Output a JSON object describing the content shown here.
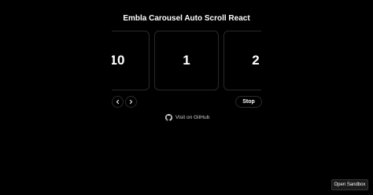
{
  "title": "Embla Carousel Auto Scroll React",
  "carousel": {
    "slides": [
      {
        "label": "10"
      },
      {
        "label": "1"
      },
      {
        "label": "2"
      }
    ]
  },
  "controls": {
    "prev_icon": "chevron-left-icon",
    "next_icon": "chevron-right-icon",
    "stop_label": "Stop"
  },
  "footer_link": {
    "icon": "github-icon",
    "label": "Visit on GitHub"
  },
  "sandbox_button": {
    "label": "Open Sandbox"
  },
  "colors": {
    "background": "#000000",
    "text": "#ffffff",
    "border": "#2a2a2a"
  }
}
